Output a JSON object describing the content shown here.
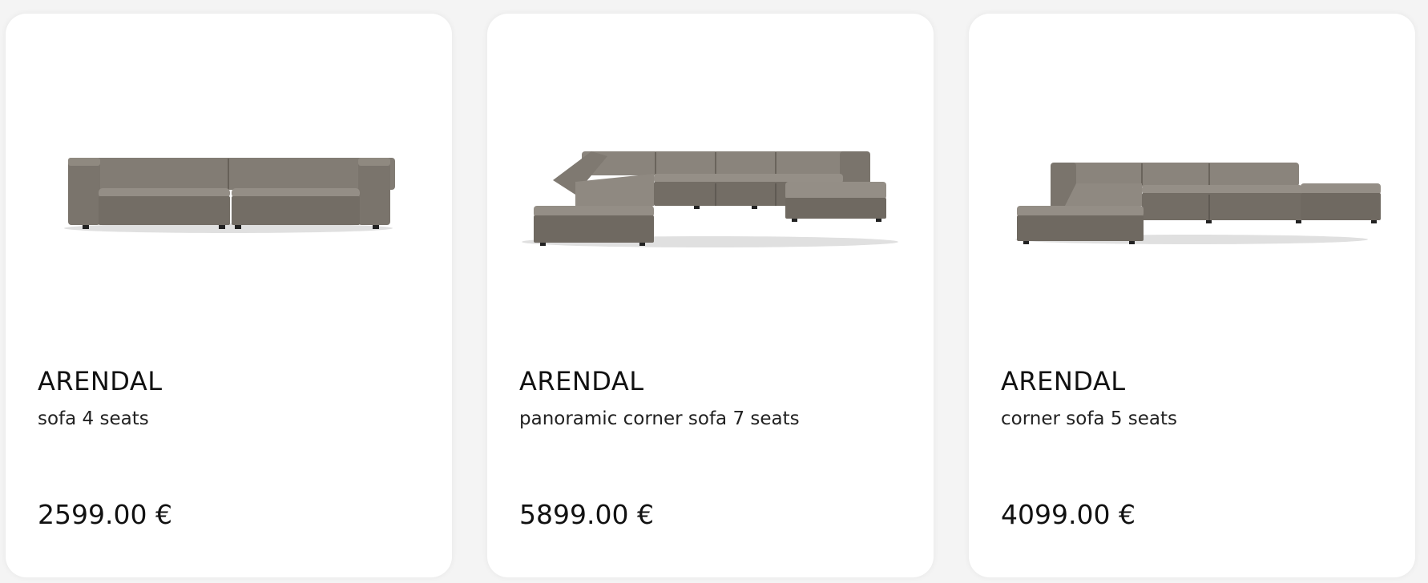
{
  "products": [
    {
      "brand": "ARENDAL",
      "model": "sofa 4 seats",
      "price": "2599.00 €",
      "image_icon": "straight-sofa-image"
    },
    {
      "brand": "ARENDAL",
      "model": "panoramic corner sofa 7 seats",
      "price": "5899.00 €",
      "image_icon": "panoramic-corner-sofa-image"
    },
    {
      "brand": "ARENDAL",
      "model": "corner sofa 5 seats",
      "price": "4099.00 €",
      "image_icon": "corner-sofa-image"
    }
  ],
  "colors": {
    "card_background": "#ffffff",
    "page_background": "#f4f4f4",
    "fabric": "#7a746c",
    "fabric_light": "#8b857d",
    "fabric_dark": "#5e5952",
    "text": "#111111"
  }
}
